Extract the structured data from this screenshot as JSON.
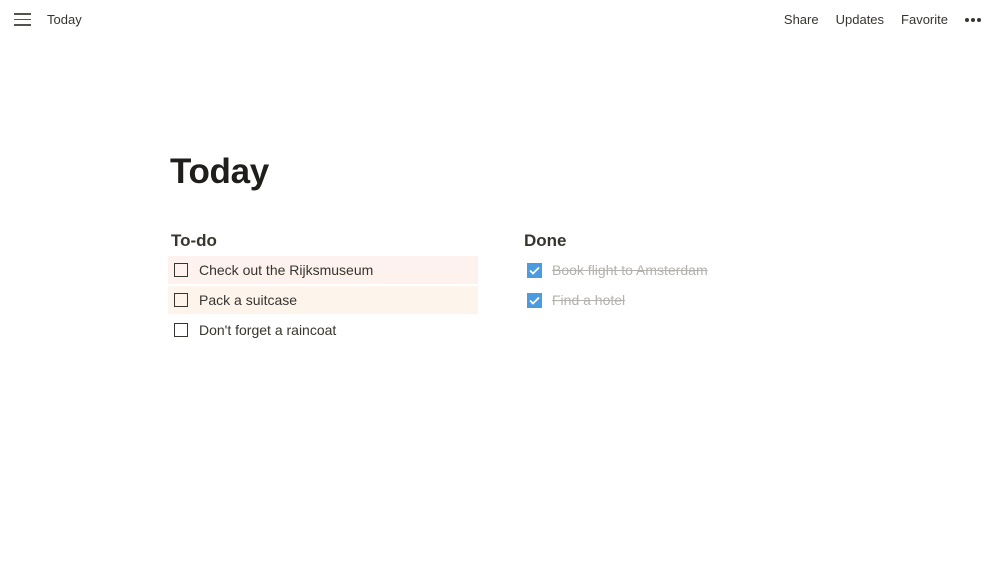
{
  "topbar": {
    "menu_icon": "hamburger-menu-icon",
    "breadcrumb": "Today",
    "actions": {
      "share": "Share",
      "updates": "Updates",
      "favorite": "Favorite",
      "more_icon": "more-horizontal-icon"
    }
  },
  "page": {
    "title": "Today",
    "todo": {
      "heading": "To-do",
      "items": [
        {
          "label": "Check out the Rijksmuseum",
          "checked": false,
          "highlight": "#fdf2ee"
        },
        {
          "label": "Pack a suitcase",
          "checked": false,
          "highlight": "#fdf5ec"
        },
        {
          "label": "Don't forget a raincoat",
          "checked": false
        }
      ]
    },
    "done": {
      "heading": "Done",
      "items": [
        {
          "label": "Book flight to Amsterdam",
          "checked": true
        },
        {
          "label": "Find a hotel",
          "checked": true
        }
      ]
    }
  },
  "colors": {
    "checkbox_checked": "#4a9be0",
    "done_text": "#b3b2ae"
  }
}
